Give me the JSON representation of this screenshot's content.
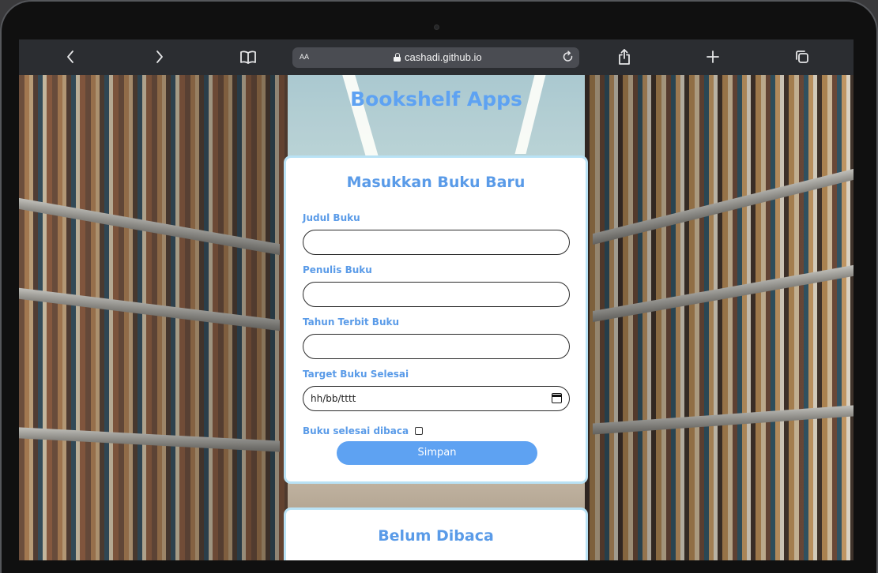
{
  "browser": {
    "text_size_label": "AA",
    "url": "cashadi.github.io"
  },
  "app": {
    "title": "Bookshelf Apps"
  },
  "input_section": {
    "title": "Masukkan Buku Baru",
    "fields": [
      {
        "label": "Judul Buku",
        "value": ""
      },
      {
        "label": "Penulis Buku",
        "value": ""
      },
      {
        "label": "Tahun Terbit Buku",
        "value": ""
      },
      {
        "label": "Target Buku Selesai",
        "value": "hh/bb/tttt"
      }
    ],
    "done_label": "Buku selesai dibaca",
    "done_checked": false,
    "submit_label": "Simpan"
  },
  "unread_section": {
    "title": "Belum Dibaca"
  },
  "colors": {
    "accent": "#5ea2f2",
    "card_border": "#b9e2f5"
  }
}
